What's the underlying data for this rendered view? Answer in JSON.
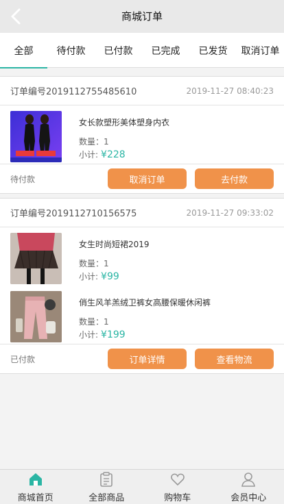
{
  "header": {
    "title": "商城订单",
    "back_icon": "chevron-left-icon"
  },
  "tabs": [
    {
      "label": "全部",
      "active": true
    },
    {
      "label": "待付款",
      "active": false
    },
    {
      "label": "已付款",
      "active": false
    },
    {
      "label": "已完成",
      "active": false
    },
    {
      "label": "已发货",
      "active": false
    },
    {
      "label": "取消订单",
      "active": false
    }
  ],
  "orders": [
    {
      "order_no": "订单编号2019112755485610",
      "time": "2019-11-27 08:40:23",
      "items": [
        {
          "name": "女长款塑形美体塑身内衣",
          "qty_label": "数量：1",
          "subtotal_label": "小计:",
          "price": "¥228"
        }
      ],
      "status": "待付款",
      "buttons": [
        "取消订单",
        "去付款"
      ]
    },
    {
      "order_no": "订单编号2019112710156575",
      "time": "2019-11-27 09:33:02",
      "items": [
        {
          "name": "女生时尚短裙2019",
          "qty_label": "数量：1",
          "subtotal_label": "小计:",
          "price": "¥99"
        },
        {
          "name": "俏生风羊羔绒卫裤女高腰保暖休闲裤",
          "qty_label": "数量：1",
          "subtotal_label": "小计:",
          "price": "¥199"
        }
      ],
      "status": "已付款",
      "buttons": [
        "订单详情",
        "查看物流"
      ]
    }
  ],
  "bottom_nav": [
    {
      "label": "商城首页",
      "icon": "home-icon",
      "active": true
    },
    {
      "label": "全部商品",
      "icon": "clipboard-icon",
      "active": false
    },
    {
      "label": "购物车",
      "icon": "heart-icon",
      "active": false
    },
    {
      "label": "会员中心",
      "icon": "user-icon",
      "active": false
    }
  ],
  "colors": {
    "accent": "#2ab5a4",
    "button": "#f0924a",
    "header_bg": "#e9e9e9"
  }
}
